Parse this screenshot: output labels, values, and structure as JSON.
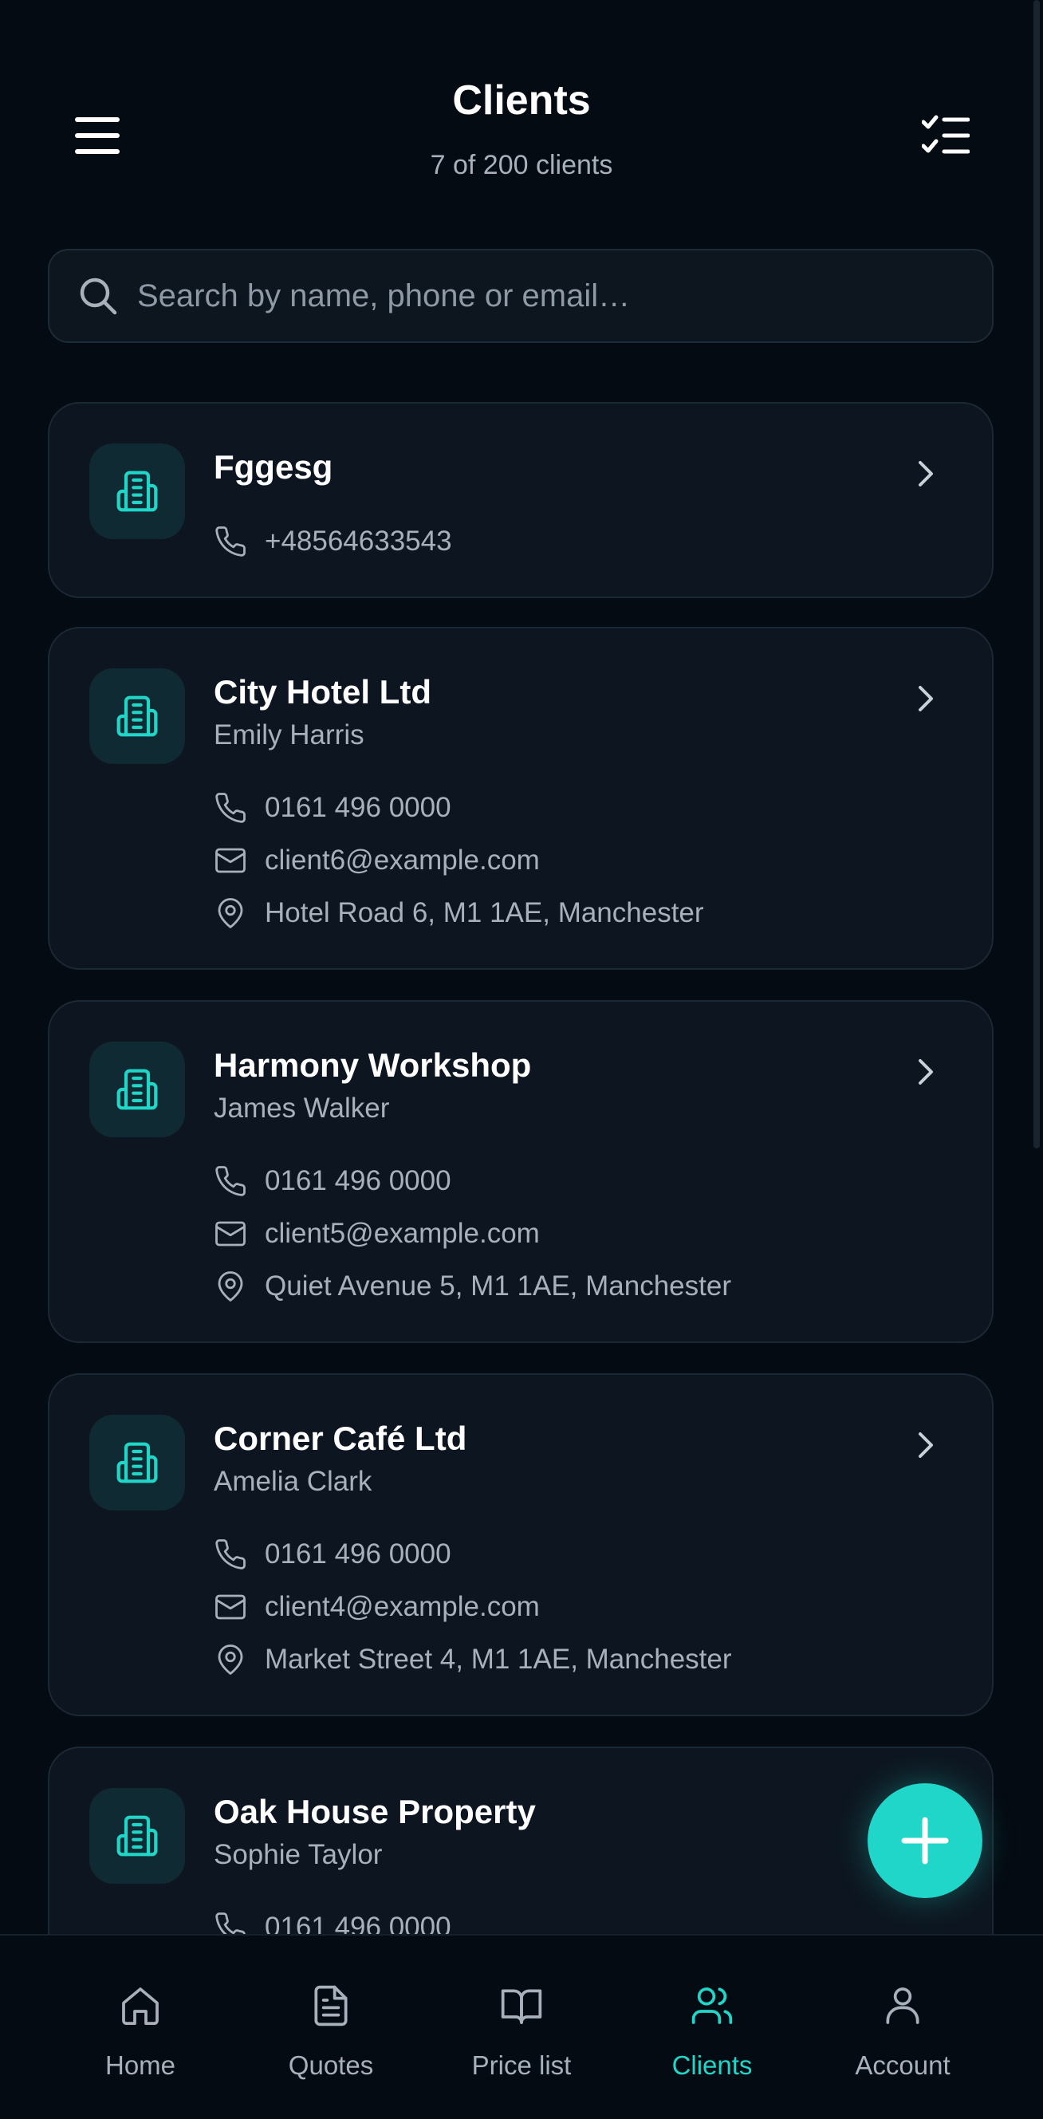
{
  "header": {
    "title": "Clients",
    "subtitle": "7 of 200 clients",
    "menu_icon": "hamburger-menu-icon",
    "select_icon": "checklist-icon"
  },
  "search": {
    "placeholder": "Search by name, phone or email…",
    "value": ""
  },
  "clients": [
    {
      "name": "Fggesg",
      "contact": "",
      "phone": "+48564633543",
      "email": "",
      "address": ""
    },
    {
      "name": "City Hotel Ltd",
      "contact": "Emily Harris",
      "phone": "0161 496 0000",
      "email": "client6@example.com",
      "address": "Hotel Road 6, M1 1AE, Manchester"
    },
    {
      "name": "Harmony Workshop",
      "contact": "James Walker",
      "phone": "0161 496 0000",
      "email": "client5@example.com",
      "address": "Quiet Avenue 5, M1 1AE, Manchester"
    },
    {
      "name": "Corner Café Ltd",
      "contact": "Amelia Clark",
      "phone": "0161 496 0000",
      "email": "client4@example.com",
      "address": "Market Street 4, M1 1AE, Manchester"
    },
    {
      "name": "Oak House Property",
      "contact": "Sophie Taylor",
      "phone": "0161 496 0000",
      "email": "",
      "address": ""
    }
  ],
  "tabs": [
    {
      "label": "Home",
      "icon": "home-icon",
      "active": false
    },
    {
      "label": "Quotes",
      "icon": "document-icon",
      "active": false
    },
    {
      "label": "Price list",
      "icon": "book-icon",
      "active": false
    },
    {
      "label": "Clients",
      "icon": "users-icon",
      "active": true
    },
    {
      "label": "Account",
      "icon": "user-icon",
      "active": false
    }
  ],
  "colors": {
    "accent": "#1fd6c8",
    "background": "#050b12",
    "card": "#0d1620",
    "muted_text": "#a7b0bb"
  }
}
